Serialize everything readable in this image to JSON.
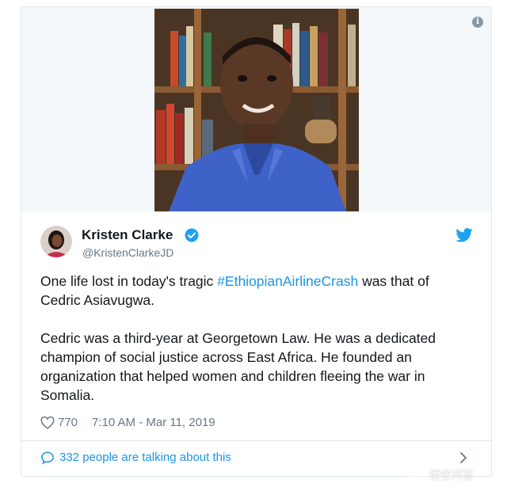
{
  "tweet": {
    "info_icon_glyph": "i",
    "author": {
      "name": "Kristen Clarke",
      "handle": "@KristenClarkeJD",
      "verified": true
    },
    "text_parts": {
      "p1_before": "One life lost in today's tragic ",
      "hashtag": "#EthiopianAirlineCrash",
      "p1_after": " was that of Cedric Asiavugwa.",
      "p2": "Cedric was a third-year at Georgetown Law. He was a dedicated champion of social justice across East Africa. He founded an organization that helped women and children fleeing the war in Somalia."
    },
    "likes": "770",
    "timestamp": "7:10 AM - Mar 11, 2019",
    "talking": "332 people are talking about this"
  },
  "icons": {
    "info": "info-icon",
    "verified": "verified-badge-icon",
    "twitter": "twitter-bird-icon",
    "heart": "heart-icon",
    "comment": "comment-bubble-icon",
    "chevron": "chevron-right-icon"
  },
  "colors": {
    "link": "#1b95e0",
    "text": "#14171a",
    "muted": "#657786",
    "border": "#e1e8ed",
    "verified": "#1da1f2"
  }
}
